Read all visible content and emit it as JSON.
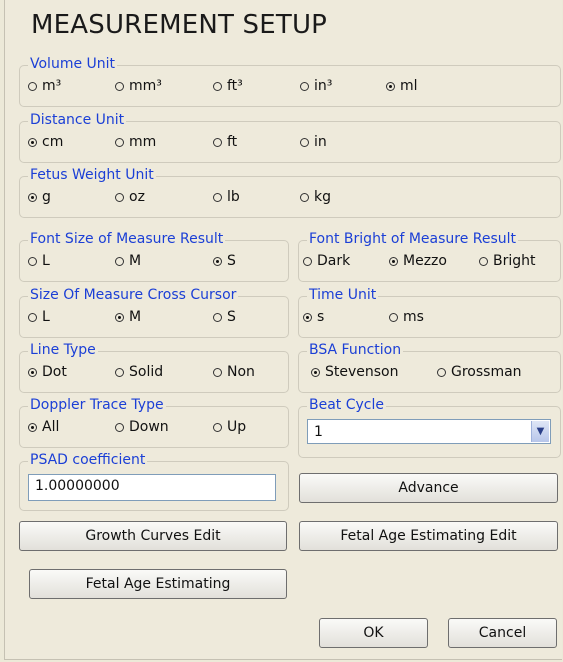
{
  "title": "MEASUREMENT SETUP",
  "volume_unit": {
    "label": "Volume Unit",
    "options": [
      "m³",
      "mm³",
      "ft³",
      "in³",
      "ml"
    ],
    "selected": "ml"
  },
  "distance_unit": {
    "label": "Distance Unit",
    "options": [
      "cm",
      "mm",
      "ft",
      "in"
    ],
    "selected": "cm"
  },
  "fetus_weight_unit": {
    "label": "Fetus Weight Unit",
    "options": [
      "g",
      "oz",
      "lb",
      "kg"
    ],
    "selected": "g"
  },
  "font_size": {
    "label": "Font Size of Measure Result",
    "options": [
      "L",
      "M",
      "S"
    ],
    "selected": "S"
  },
  "font_bright": {
    "label": "Font Bright of Measure Result",
    "options": [
      "Dark",
      "Mezzo",
      "Bright"
    ],
    "selected": "Mezzo"
  },
  "cross_cursor": {
    "label": "Size Of Measure Cross Cursor",
    "options": [
      "L",
      "M",
      "S"
    ],
    "selected": "M"
  },
  "time_unit": {
    "label": "Time Unit",
    "options": [
      "s",
      "ms"
    ],
    "selected": "s"
  },
  "line_type": {
    "label": "Line Type",
    "options": [
      "Dot",
      "Solid",
      "Non"
    ],
    "selected": "Dot"
  },
  "bsa_function": {
    "label": "BSA Function",
    "options": [
      "Stevenson",
      "Grossman"
    ],
    "selected": "Stevenson"
  },
  "doppler_trace": {
    "label": "Doppler Trace Type",
    "options": [
      "All",
      "Down",
      "Up"
    ],
    "selected": "All"
  },
  "beat_cycle": {
    "label": "Beat Cycle",
    "value": "1"
  },
  "psad": {
    "label": "PSAD coefficient",
    "value": "1.00000000"
  },
  "buttons": {
    "advance": "Advance",
    "growth_curves_edit": "Growth Curves Edit",
    "fetal_age_estimating_edit": "Fetal Age Estimating Edit",
    "fetal_age_estimating": "Fetal Age Estimating",
    "ok": "OK",
    "cancel": "Cancel"
  },
  "colors": {
    "group_label": "#1b3fd6",
    "background": "#eeeadb"
  }
}
